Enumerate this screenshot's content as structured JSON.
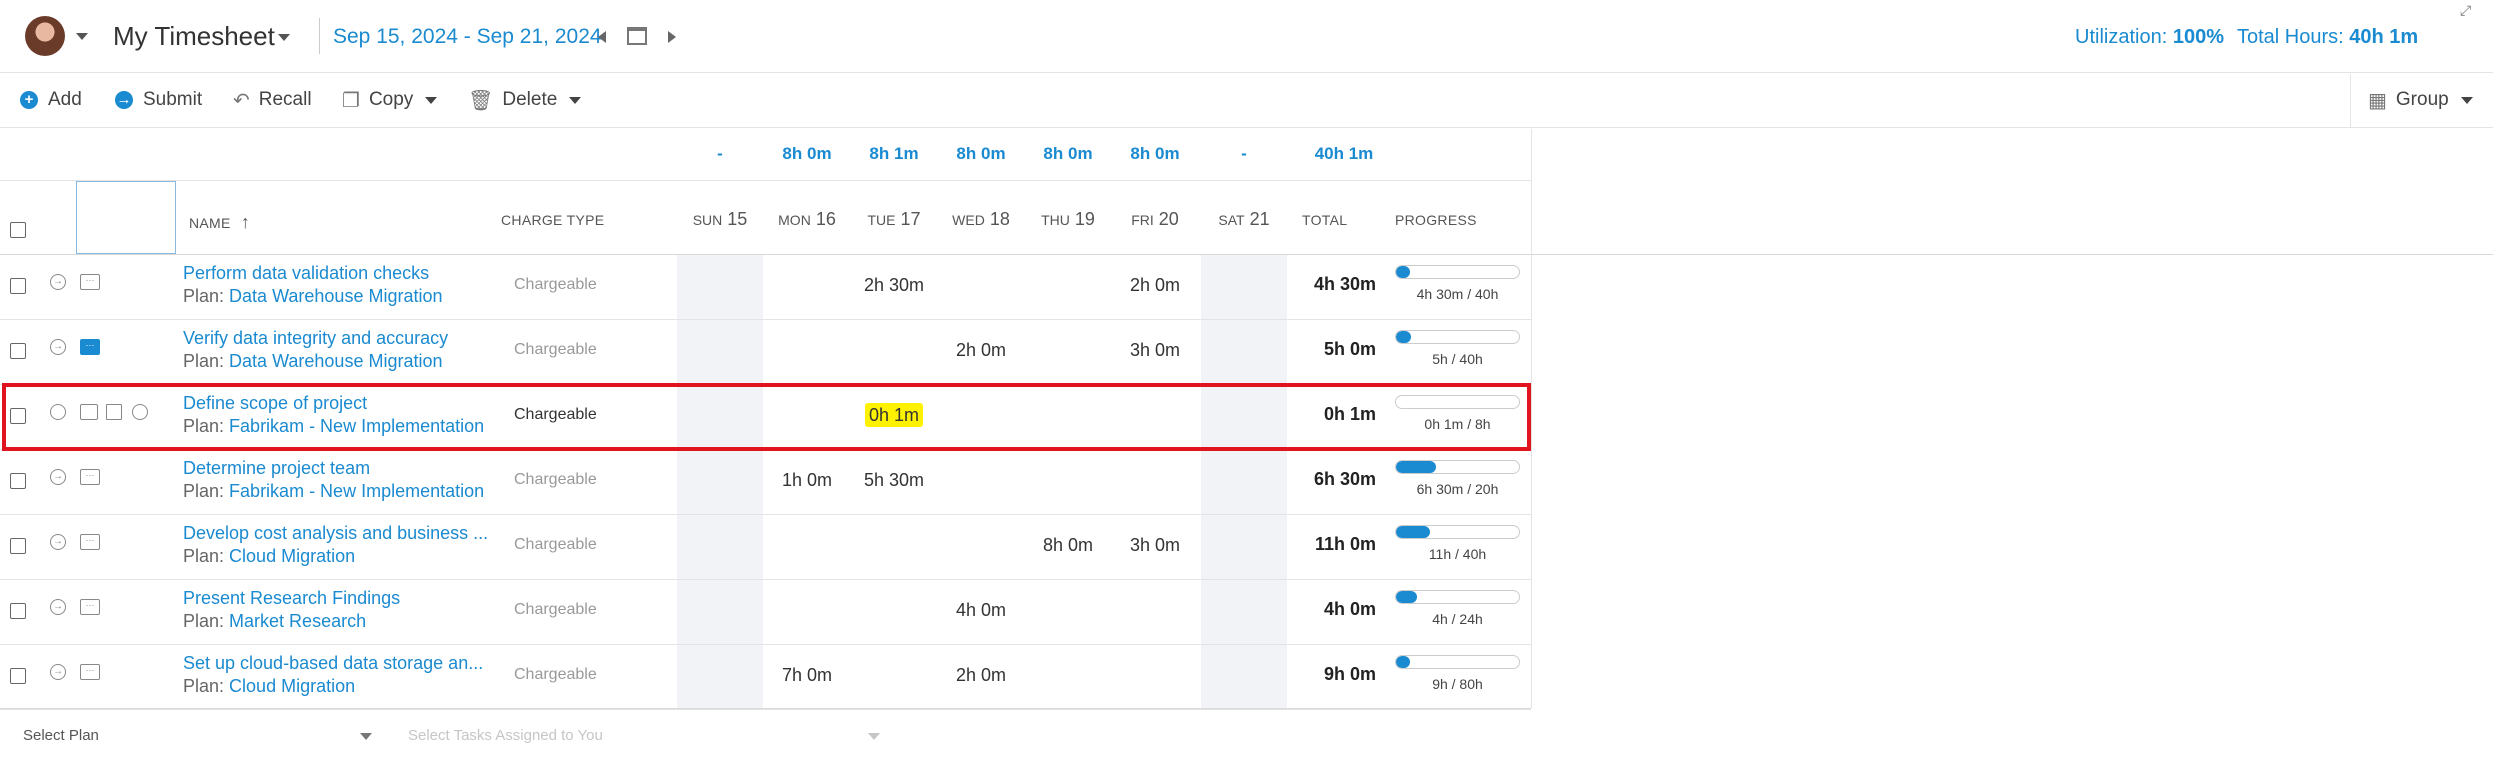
{
  "header": {
    "title": "My Timesheet",
    "date_range": "Sep 15, 2024 - Sep 21, 2024",
    "utilization_label": "Utilization:",
    "utilization_value": "100%",
    "total_hours_label": "Total Hours:",
    "total_hours_value": "40h 1m"
  },
  "toolbar": {
    "add": "Add",
    "submit": "Submit",
    "recall": "Recall",
    "copy": "Copy",
    "delete": "Delete",
    "group": "Group"
  },
  "day_totals": [
    "-",
    "8h 0m",
    "8h 1m",
    "8h 0m",
    "8h 0m",
    "8h 0m",
    "-"
  ],
  "grand_total": "40h 1m",
  "columns": {
    "name": "NAME",
    "charge_type": "CHARGE TYPE",
    "days": [
      {
        "dow": "SUN",
        "num": "15"
      },
      {
        "dow": "MON",
        "num": "16"
      },
      {
        "dow": "TUE",
        "num": "17"
      },
      {
        "dow": "WED",
        "num": "18"
      },
      {
        "dow": "THU",
        "num": "19"
      },
      {
        "dow": "FRI",
        "num": "20"
      },
      {
        "dow": "SAT",
        "num": "21"
      }
    ],
    "total": "TOTAL",
    "progress": "PROGRESS"
  },
  "rows": [
    {
      "name": "Perform data validation checks",
      "plan_label": "Plan:",
      "plan": "Data Warehouse Migration",
      "charge": "Chargeable",
      "hours": [
        "",
        "",
        "2h 30m",
        "",
        "",
        "2h 0m",
        ""
      ],
      "total": "4h 30m",
      "progress": 0.1125,
      "progress_label": "4h 30m / 40h"
    },
    {
      "name": "Verify data integrity and accuracy",
      "plan_label": "Plan:",
      "plan": "Data Warehouse Migration",
      "charge": "Chargeable",
      "hours": [
        "",
        "",
        "",
        "2h 0m",
        "",
        "3h 0m",
        ""
      ],
      "total": "5h 0m",
      "progress": 0.125,
      "progress_label": "5h / 40h"
    },
    {
      "name": "Define scope of project",
      "plan_label": "Plan:",
      "plan": "Fabrikam - New Implementation",
      "charge": "Chargeable",
      "hours": [
        "",
        "",
        "0h 1m",
        "",
        "",
        "",
        ""
      ],
      "total": "0h 1m",
      "progress": 0.002,
      "progress_label": "0h 1m / 8h"
    },
    {
      "name": "Determine project team",
      "plan_label": "Plan:",
      "plan": "Fabrikam - New Implementation",
      "charge": "Chargeable",
      "hours": [
        "",
        "1h 0m",
        "5h 30m",
        "",
        "",
        "",
        ""
      ],
      "total": "6h 30m",
      "progress": 0.325,
      "progress_label": "6h 30m / 20h"
    },
    {
      "name": "Develop cost analysis and business ...",
      "plan_label": "Plan:",
      "plan": "Cloud Migration",
      "charge": "Chargeable",
      "hours": [
        "",
        "",
        "",
        "",
        "8h 0m",
        "3h 0m",
        ""
      ],
      "total": "11h 0m",
      "progress": 0.275,
      "progress_label": "11h / 40h"
    },
    {
      "name": "Present Research Findings",
      "plan_label": "Plan:",
      "plan": "Market Research",
      "charge": "Chargeable",
      "hours": [
        "",
        "",
        "",
        "4h 0m",
        "",
        "",
        ""
      ],
      "total": "4h 0m",
      "progress": 0.1667,
      "progress_label": "4h / 24h"
    },
    {
      "name": "Set up cloud-based data storage an...",
      "plan_label": "Plan:",
      "plan": "Cloud Migration",
      "charge": "Chargeable",
      "hours": [
        "",
        "7h 0m",
        "",
        "2h 0m",
        "",
        "",
        ""
      ],
      "total": "9h 0m",
      "progress": 0.1125,
      "progress_label": "9h / 80h"
    }
  ],
  "footer": {
    "select_plan": "Select Plan",
    "select_tasks": "Select Tasks Assigned to You"
  },
  "colors": {
    "accent": "#1a8ad1",
    "highlight_frame": "#e0141e",
    "hours_highlight": "#fff200"
  }
}
